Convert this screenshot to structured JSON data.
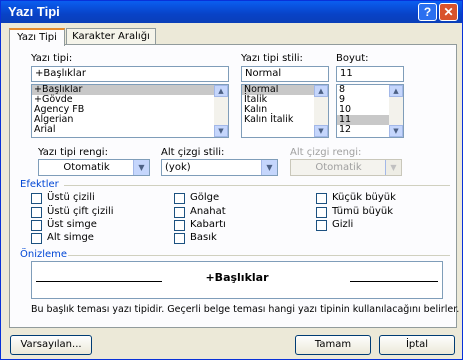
{
  "window": {
    "title": "Yazı Tipi",
    "help_glyph": "?",
    "close_glyph": "✕"
  },
  "tabs": [
    {
      "label": "Yazı Tipi",
      "active": true
    },
    {
      "label": "Karakter Aralığı",
      "active": false
    }
  ],
  "font": {
    "label": "Yazı tipi:",
    "value": "+Başlıklar",
    "items": [
      "+Başlıklar",
      "+Gövde",
      "Agency FB",
      "Algerian",
      "Arial"
    ],
    "selected": "+Başlıklar"
  },
  "style": {
    "label": "Yazı tipi stili:",
    "value": "Normal",
    "items": [
      "Normal",
      "İtalik",
      "Kalın",
      "Kalın İtalik"
    ],
    "selected": "Normal"
  },
  "size": {
    "label": "Boyut:",
    "value": "11",
    "items": [
      "8",
      "9",
      "10",
      "11",
      "12"
    ],
    "selected": "11"
  },
  "font_color": {
    "label": "Yazı tipi rengi:",
    "value": "Otomatik"
  },
  "underline_style": {
    "label": "Alt çizgi stili:",
    "value": "(yok)"
  },
  "underline_color": {
    "label": "Alt çizgi rengi:",
    "value": "Otomatik",
    "disabled": true
  },
  "effects": {
    "label": "Efektler",
    "items": [
      {
        "label": "Üstü çizili",
        "checked": false
      },
      {
        "label": "Üstü çift çizili",
        "checked": false
      },
      {
        "label": "Üst simge",
        "checked": false
      },
      {
        "label": "Alt simge",
        "checked": false
      },
      {
        "label": "Gölge",
        "checked": false
      },
      {
        "label": "Anahat",
        "checked": false
      },
      {
        "label": "Kabartı",
        "checked": false
      },
      {
        "label": "Basık",
        "checked": false
      },
      {
        "label": "Küçük büyük",
        "checked": false
      },
      {
        "label": "Tümü büyük",
        "checked": false
      },
      {
        "label": "Gizli",
        "checked": false
      }
    ]
  },
  "preview": {
    "label": "Önizleme",
    "sample": "+Başlıklar",
    "description": "Bu başlık teması yazı tipidir. Geçerli belge teması hangi yazı tipinin kullanılacağını belirler."
  },
  "buttons": {
    "default": "Varsayılan...",
    "ok": "Tamam",
    "cancel": "İptal"
  },
  "colors": {
    "title_bar": "#0842c7",
    "dialog_bg": "#ece9d8",
    "group_label": "#0046d5",
    "active_tab_accent": "#e68b2c"
  }
}
